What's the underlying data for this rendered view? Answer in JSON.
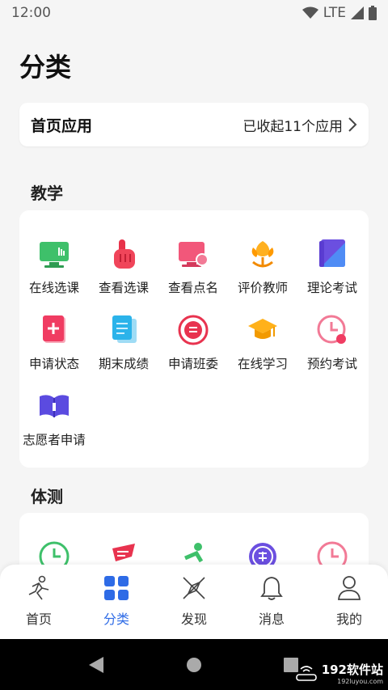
{
  "status_bar": {
    "time": "12:00",
    "network": "LTE"
  },
  "page_title": "分类",
  "home_apps": {
    "title": "首页应用",
    "summary": "已收起11个应用"
  },
  "sections": {
    "teaching": {
      "title": "教学",
      "items": [
        {
          "label": "在线选课",
          "icon": "monitor-icon"
        },
        {
          "label": "查看选课",
          "icon": "hand-pointer-icon"
        },
        {
          "label": "查看点名",
          "icon": "roll-call-icon"
        },
        {
          "label": "评价教师",
          "icon": "flower-icon"
        },
        {
          "label": "理论考试",
          "icon": "exam-book-icon"
        },
        {
          "label": "申请状态",
          "icon": "application-status-icon"
        },
        {
          "label": "期末成绩",
          "icon": "grade-sheet-icon"
        },
        {
          "label": "申请班委",
          "icon": "class-committee-icon"
        },
        {
          "label": "在线学习",
          "icon": "graduation-cap-icon"
        },
        {
          "label": "预约考试",
          "icon": "clock-icon"
        },
        {
          "label": "志愿者申请",
          "icon": "volunteer-book-icon"
        }
      ]
    },
    "fitness": {
      "title": "体测",
      "items": [
        {
          "icon": "clock-green-icon"
        },
        {
          "icon": "running-text-icon"
        },
        {
          "icon": "runner-icon"
        },
        {
          "icon": "exempt-icon"
        },
        {
          "icon": "clock-pink-icon"
        }
      ]
    }
  },
  "bottom_nav": [
    {
      "label": "首页",
      "icon": "runner-nav-icon",
      "active": false
    },
    {
      "label": "分类",
      "icon": "grid-icon",
      "active": true
    },
    {
      "label": "发现",
      "icon": "compass-icon",
      "active": false
    },
    {
      "label": "消息",
      "icon": "bell-icon",
      "active": false
    },
    {
      "label": "我的",
      "icon": "user-icon",
      "active": false
    }
  ],
  "watermark": {
    "name": "192软件站",
    "url": "192luyou.com"
  },
  "colors": {
    "accent": "#2e6be6",
    "background": "#f5f5f5"
  }
}
